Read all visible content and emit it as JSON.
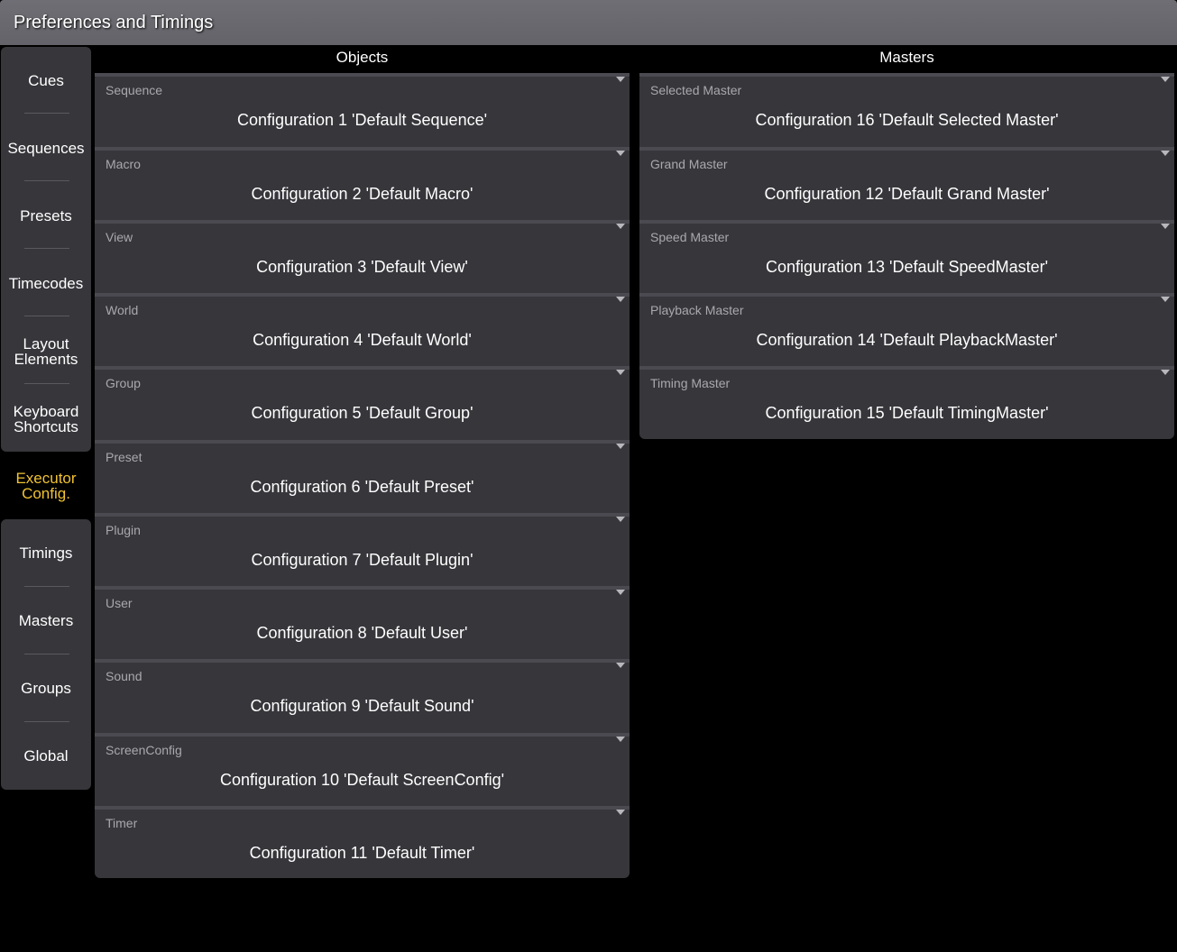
{
  "window": {
    "title": "Preferences and Timings"
  },
  "sidebar": {
    "items": [
      {
        "label": "Cues"
      },
      {
        "label": "Sequences"
      },
      {
        "label": "Presets"
      },
      {
        "label": "Timecodes"
      },
      {
        "label": "Layout Elements"
      },
      {
        "label": "Keyboard Shortcuts"
      },
      {
        "label": "Executor Config."
      },
      {
        "label": "Timings"
      },
      {
        "label": "Masters"
      },
      {
        "label": "Groups"
      },
      {
        "label": "Global"
      }
    ],
    "active_label": "Executor Config.",
    "active_color": "#f1c232"
  },
  "objects": {
    "header": "Objects",
    "items": [
      {
        "label": "Sequence",
        "value": "Configuration 1 'Default Sequence'"
      },
      {
        "label": "Macro",
        "value": "Configuration 2 'Default Macro'"
      },
      {
        "label": "View",
        "value": "Configuration 3 'Default View'"
      },
      {
        "label": "World",
        "value": "Configuration 4 'Default World'"
      },
      {
        "label": "Group",
        "value": "Configuration 5 'Default Group'"
      },
      {
        "label": "Preset",
        "value": "Configuration 6 'Default Preset'"
      },
      {
        "label": "Plugin",
        "value": "Configuration 7 'Default Plugin'"
      },
      {
        "label": "User",
        "value": "Configuration 8 'Default User'"
      },
      {
        "label": "Sound",
        "value": "Configuration 9 'Default Sound'"
      },
      {
        "label": "ScreenConfig",
        "value": "Configuration 10 'Default ScreenConfig'"
      },
      {
        "label": "Timer",
        "value": "Configuration 11 'Default Timer'"
      }
    ]
  },
  "masters": {
    "header": "Masters",
    "items": [
      {
        "label": "Selected Master",
        "value": "Configuration 16 'Default Selected Master'"
      },
      {
        "label": "Grand Master",
        "value": "Configuration 12 'Default Grand Master'"
      },
      {
        "label": "Speed Master",
        "value": "Configuration 13 'Default SpeedMaster'"
      },
      {
        "label": "Playback Master",
        "value": "Configuration 14 'Default PlaybackMaster'"
      },
      {
        "label": "Timing Master",
        "value": "Configuration 15 'Default TimingMaster'"
      }
    ]
  }
}
